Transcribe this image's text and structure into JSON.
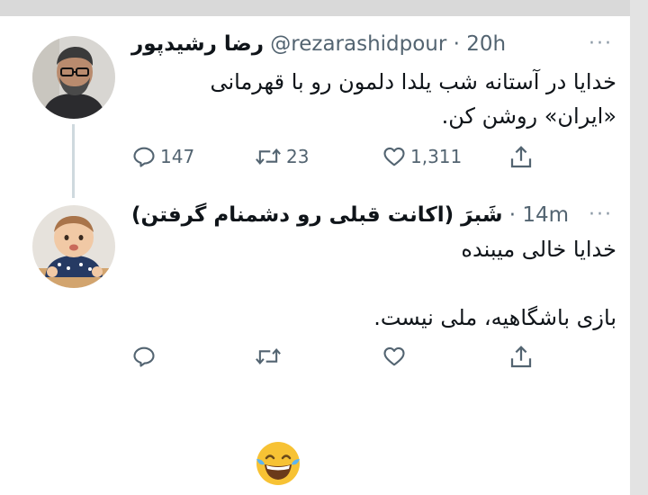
{
  "tweet1": {
    "display_name": "رضا رشیدپور",
    "handle": "@rezarashidpour",
    "time": "· 20h",
    "more": "···",
    "text_line1": "خدایا در آستانه شب یلدا دلمون رو با قهرمانی",
    "text_line2": "«ایران» روشن کن.",
    "replies": "147",
    "retweets": "23",
    "likes": "1,311"
  },
  "tweet2": {
    "display_name": "شَبرَ (اکانت قبلی رو دشمنام گرفتن)",
    "time": "· 14m",
    "more": "···",
    "text_line1": "خدایا خالی میبنده",
    "text_line2": "بازی باشگاهیه، ملی نیست."
  },
  "emoji": "face-with-tears-of-joy",
  "colors": {
    "text": "#0f1419",
    "muted": "#536471",
    "thread": "#cfd9de",
    "emoji_face": "#f7c234"
  }
}
